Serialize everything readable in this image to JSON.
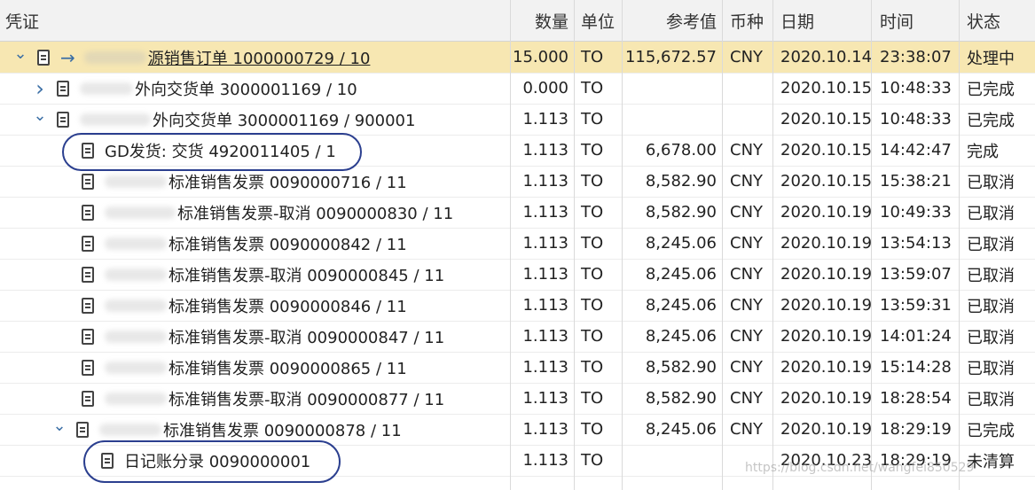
{
  "columns": {
    "voucher": "凭证",
    "qty": "数量",
    "unit": "单位",
    "ref": "参考值",
    "currency": "币种",
    "date": "日期",
    "time": "时间",
    "status": "状态"
  },
  "rows": [
    {
      "toggle": "chevron-down",
      "arrow": true,
      "text": "源销售订单 1000000729 / 10",
      "qty": "15.000",
      "unit": "TO",
      "ref": "115,672.57",
      "currency": "CNY",
      "date": "2020.10.14",
      "time": "23:38:07",
      "status": "处理中"
    },
    {
      "toggle": "chevron-right",
      "arrow": false,
      "text": "外向交货单 3000001169 / 10",
      "qty": "0.000",
      "unit": "TO",
      "ref": "",
      "currency": "",
      "date": "2020.10.15",
      "time": "10:48:33",
      "status": "已完成"
    },
    {
      "toggle": "chevron-down",
      "arrow": false,
      "text": "外向交货单 3000001169 / 900001",
      "qty": "1.113",
      "unit": "TO",
      "ref": "",
      "currency": "",
      "date": "2020.10.15",
      "time": "10:48:33",
      "status": "已完成"
    },
    {
      "toggle": "",
      "arrow": false,
      "text": "GD发货: 交货 4920011405 / 1",
      "qty": "1.113",
      "unit": "TO",
      "ref": "6,678.00",
      "currency": "CNY",
      "date": "2020.10.15",
      "time": "14:42:47",
      "status": "完成"
    },
    {
      "toggle": "",
      "arrow": false,
      "text": "标准销售发票 0090000716 / 11",
      "qty": "1.113",
      "unit": "TO",
      "ref": "8,582.90",
      "currency": "CNY",
      "date": "2020.10.15",
      "time": "15:38:21",
      "status": "已取消"
    },
    {
      "toggle": "",
      "arrow": false,
      "text": "标准销售发票-取消 0090000830 / 11",
      "qty": "1.113",
      "unit": "TO",
      "ref": "8,582.90",
      "currency": "CNY",
      "date": "2020.10.19",
      "time": "10:49:33",
      "status": "已取消"
    },
    {
      "toggle": "",
      "arrow": false,
      "text": "标准销售发票 0090000842 / 11",
      "qty": "1.113",
      "unit": "TO",
      "ref": "8,245.06",
      "currency": "CNY",
      "date": "2020.10.19",
      "time": "13:54:13",
      "status": "已取消"
    },
    {
      "toggle": "",
      "arrow": false,
      "text": "标准销售发票-取消 0090000845 / 11",
      "qty": "1.113",
      "unit": "TO",
      "ref": "8,245.06",
      "currency": "CNY",
      "date": "2020.10.19",
      "time": "13:59:07",
      "status": "已取消"
    },
    {
      "toggle": "",
      "arrow": false,
      "text": "标准销售发票 0090000846 / 11",
      "qty": "1.113",
      "unit": "TO",
      "ref": "8,245.06",
      "currency": "CNY",
      "date": "2020.10.19",
      "time": "13:59:31",
      "status": "已取消"
    },
    {
      "toggle": "",
      "arrow": false,
      "text": "标准销售发票-取消 0090000847 / 11",
      "qty": "1.113",
      "unit": "TO",
      "ref": "8,245.06",
      "currency": "CNY",
      "date": "2020.10.19",
      "time": "14:01:24",
      "status": "已取消"
    },
    {
      "toggle": "",
      "arrow": false,
      "text": "标准销售发票 0090000865 / 11",
      "qty": "1.113",
      "unit": "TO",
      "ref": "8,582.90",
      "currency": "CNY",
      "date": "2020.10.19",
      "time": "15:14:28",
      "status": "已取消"
    },
    {
      "toggle": "",
      "arrow": false,
      "text": "标准销售发票-取消 0090000877 / 11",
      "qty": "1.113",
      "unit": "TO",
      "ref": "8,582.90",
      "currency": "CNY",
      "date": "2020.10.19",
      "time": "18:28:54",
      "status": "已取消"
    },
    {
      "toggle": "chevron-down",
      "arrow": false,
      "text": "标准销售发票 0090000878 / 11",
      "qty": "1.113",
      "unit": "TO",
      "ref": "8,245.06",
      "currency": "CNY",
      "date": "2020.10.19",
      "time": "18:29:19",
      "status": "已完成"
    },
    {
      "toggle": "",
      "arrow": false,
      "text": "日记账分录 0090000001",
      "qty": "1.113",
      "unit": "TO",
      "ref": "",
      "currency": "",
      "date": "2020.10.23",
      "time": "18:29:19",
      "status": "未清算"
    }
  ],
  "watermark": "https://blog.csdn.net/wangfei850529",
  "colors": {
    "selected_row": "#f7e7b2",
    "header_bg": "#f2f2f2",
    "circle": "#2b3f8f",
    "toggle": "#3a6ea5"
  }
}
